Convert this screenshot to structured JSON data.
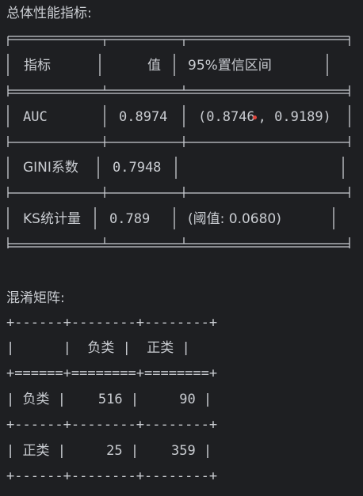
{
  "metrics": {
    "heading": "总体性能指标:",
    "headers": {
      "metric": "指标",
      "value": "值",
      "ci": "95%置信区间"
    },
    "rows": [
      {
        "metric": "AUC",
        "value": "0.8974",
        "ci_open": "(0.8746",
        "ci_sep": ",",
        "ci_close": " 0.9189)"
      },
      {
        "metric": "GINI系数",
        "value": "0.7948",
        "ci": ""
      },
      {
        "metric": "KS统计量",
        "value": "0.789",
        "ci": "(阈值: 0.0680)"
      }
    ]
  },
  "confusion": {
    "heading": "混淆矩阵:",
    "border_top": "+------+--------+--------+",
    "header_line": "|      |  负类 |  正类 |",
    "border_double": "+======+========+========+",
    "row1": "| 负类 |    516 |     90 |",
    "border_mid": "+------+--------+--------+",
    "row2": "| 正类 |     25 |    359 |",
    "border_bottom": "+------+--------+--------+"
  },
  "colors": {
    "background": "#1e1f22",
    "text": "#c9ccd1",
    "cursor_dot": "#e2463d"
  }
}
